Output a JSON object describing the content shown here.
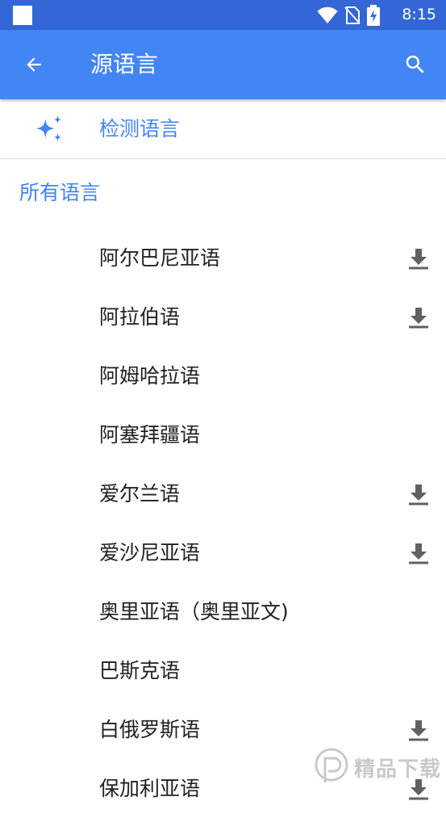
{
  "status_bar": {
    "time": "8:15",
    "icons": [
      "wifi-icon",
      "no-sim-icon",
      "battery-charging-icon"
    ]
  },
  "app_bar": {
    "title": "源语言",
    "back_icon": "arrow-back-icon",
    "search_icon": "search-icon"
  },
  "detect": {
    "label": "检测语言",
    "icon": "sparkle-icon"
  },
  "section": {
    "header": "所有语言"
  },
  "languages": [
    {
      "label": "阿尔巴尼亚语",
      "downloadable": true
    },
    {
      "label": "阿拉伯语",
      "downloadable": true
    },
    {
      "label": "阿姆哈拉语",
      "downloadable": false
    },
    {
      "label": "阿塞拜疆语",
      "downloadable": false
    },
    {
      "label": "爱尔兰语",
      "downloadable": true
    },
    {
      "label": "爱沙尼亚语",
      "downloadable": true
    },
    {
      "label": "奥里亚语（奥里亚文)",
      "downloadable": false
    },
    {
      "label": "巴斯克语",
      "downloadable": false
    },
    {
      "label": "白俄罗斯语",
      "downloadable": true
    },
    {
      "label": "保加利亚语",
      "downloadable": true
    }
  ],
  "watermark": {
    "text": "精品下载"
  },
  "colors": {
    "status_bar": "#3367d6",
    "app_bar": "#4285f4",
    "accent": "#4285f4",
    "text_primary": "#212121",
    "icon_gray": "#616161"
  }
}
